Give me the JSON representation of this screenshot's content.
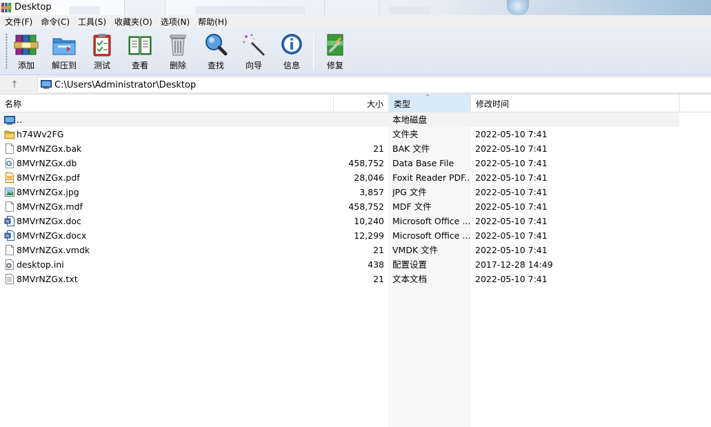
{
  "window": {
    "title": "Desktop"
  },
  "menu": {
    "items": [
      "文件(F)",
      "命令(C)",
      "工具(S)",
      "收藏夹(O)",
      "选项(N)",
      "帮助(H)"
    ]
  },
  "toolbar": {
    "buttons": [
      {
        "label": "添加",
        "icon": "add-archive-icon"
      },
      {
        "label": "解压到",
        "icon": "extract-folder-icon"
      },
      {
        "label": "测试",
        "icon": "test-clipboard-icon"
      },
      {
        "label": "查看",
        "icon": "view-book-icon"
      },
      {
        "label": "删除",
        "icon": "trash-icon"
      },
      {
        "label": "查找",
        "icon": "magnifier-icon"
      },
      {
        "label": "向导",
        "icon": "wizard-wand-icon"
      },
      {
        "label": "信息",
        "icon": "info-icon"
      },
      {
        "label": "修复",
        "icon": "repair-icon"
      }
    ]
  },
  "address": {
    "path": "C:\\Users\\Administrator\\Desktop"
  },
  "columns": {
    "name": "名称",
    "size": "大小",
    "type": "类型",
    "modified": "修改时间"
  },
  "files": [
    {
      "name": "..",
      "size": "",
      "type": "本地磁盘",
      "modified": "",
      "icon": "drive-icon"
    },
    {
      "name": "h74Wv2FG",
      "size": "",
      "type": "文件夹",
      "modified": "2022-05-10 7:41",
      "icon": "folder-icon"
    },
    {
      "name": "8MVrNZGx.bak",
      "size": "21",
      "type": "BAK 文件",
      "modified": "2022-05-10 7:41",
      "icon": "blank-file-icon"
    },
    {
      "name": "8MVrNZGx.db",
      "size": "458,752",
      "type": "Data Base File",
      "modified": "2022-05-10 7:41",
      "icon": "db-file-icon"
    },
    {
      "name": "8MVrNZGx.pdf",
      "size": "28,046",
      "type": "Foxit Reader PDF...",
      "modified": "2022-05-10 7:41",
      "icon": "pdf-file-icon"
    },
    {
      "name": "8MVrNZGx.jpg",
      "size": "3,857",
      "type": "JPG 文件",
      "modified": "2022-05-10 7:41",
      "icon": "image-file-icon"
    },
    {
      "name": "8MVrNZGx.mdf",
      "size": "458,752",
      "type": "MDF 文件",
      "modified": "2022-05-10 7:41",
      "icon": "blank-file-icon"
    },
    {
      "name": "8MVrNZGx.doc",
      "size": "10,240",
      "type": "Microsoft Office ...",
      "modified": "2022-05-10 7:41",
      "icon": "word-file-icon"
    },
    {
      "name": "8MVrNZGx.docx",
      "size": "12,299",
      "type": "Microsoft Office ...",
      "modified": "2022-05-10 7:41",
      "icon": "word-file-icon"
    },
    {
      "name": "8MVrNZGx.vmdk",
      "size": "21",
      "type": "VMDK 文件",
      "modified": "2022-05-10 7:41",
      "icon": "blank-file-icon"
    },
    {
      "name": "desktop.ini",
      "size": "438",
      "type": "配置设置",
      "modified": "2017-12-28 14:49",
      "icon": "settings-file-icon"
    },
    {
      "name": "8MVrNZGx.txt",
      "size": "21",
      "type": "文本文档",
      "modified": "2022-05-10 7:41",
      "icon": "text-file-icon"
    }
  ],
  "colors": {
    "toolbar_bg": "#e4ebf5",
    "sorted_header": "#d9ebf9",
    "type_column_bg": "#f7f7f7"
  }
}
